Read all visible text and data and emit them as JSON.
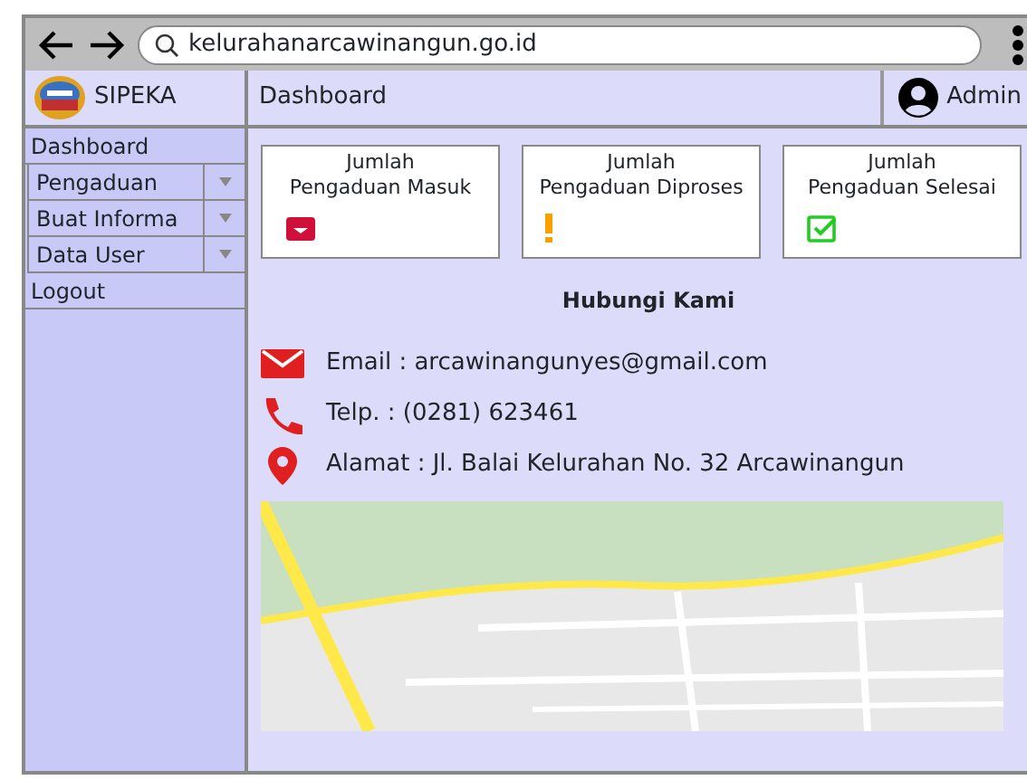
{
  "browser": {
    "url": "kelurahanarcawinangun.go.id"
  },
  "app": {
    "title": "SIPEKA"
  },
  "sidebar": {
    "items": [
      {
        "label": "Dashboard",
        "kind": "link"
      },
      {
        "label": "Pengaduan",
        "kind": "dropdown"
      },
      {
        "label": "Buat Informa",
        "kind": "dropdown"
      },
      {
        "label": "Data User",
        "kind": "dropdown"
      },
      {
        "label": "Logout",
        "kind": "link"
      }
    ]
  },
  "header": {
    "title": "Dashboard",
    "user": "Admin"
  },
  "cards": [
    {
      "title": "Jumlah\nPengaduan Masuk",
      "kind": "inbox"
    },
    {
      "title": "Jumlah\nPengaduan Diproses",
      "kind": "warning"
    },
    {
      "title": "Jumlah\nPengaduan Selesai",
      "kind": "done"
    }
  ],
  "contact": {
    "heading": "Hubungi Kami",
    "items": [
      {
        "text": "Email : arcawinangunyes@gmail.com",
        "kind": "email"
      },
      {
        "text": "Telp. : (0281) 623461",
        "kind": "phone"
      },
      {
        "text": "Alamat : Jl. Balai Kelurahan No. 32 Arcawinangun",
        "kind": "address"
      }
    ]
  }
}
